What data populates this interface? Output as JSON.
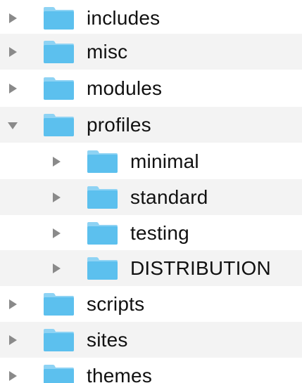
{
  "tree": {
    "items": [
      {
        "label": "includes",
        "level": 0,
        "expanded": false
      },
      {
        "label": "misc",
        "level": 0,
        "expanded": false
      },
      {
        "label": "modules",
        "level": 0,
        "expanded": false
      },
      {
        "label": "profiles",
        "level": 0,
        "expanded": true
      },
      {
        "label": "minimal",
        "level": 1,
        "expanded": false
      },
      {
        "label": "standard",
        "level": 1,
        "expanded": false
      },
      {
        "label": "testing",
        "level": 1,
        "expanded": false
      },
      {
        "label": "DISTRIBUTION",
        "level": 1,
        "expanded": false
      },
      {
        "label": "scripts",
        "level": 0,
        "expanded": false
      },
      {
        "label": "sites",
        "level": 0,
        "expanded": false
      },
      {
        "label": "themes",
        "level": 0,
        "expanded": false
      }
    ]
  },
  "icons": {
    "disclosure_collapsed": "disclosure-triangle-right-icon",
    "disclosure_expanded": "disclosure-triangle-down-icon",
    "folder": "folder-icon"
  },
  "colors": {
    "folder_body": "#5cc0ee",
    "folder_tab": "#8ed3f4",
    "disclosure": "#8a8a8a",
    "row_alt": "#f3f3f3",
    "text": "#111111"
  }
}
